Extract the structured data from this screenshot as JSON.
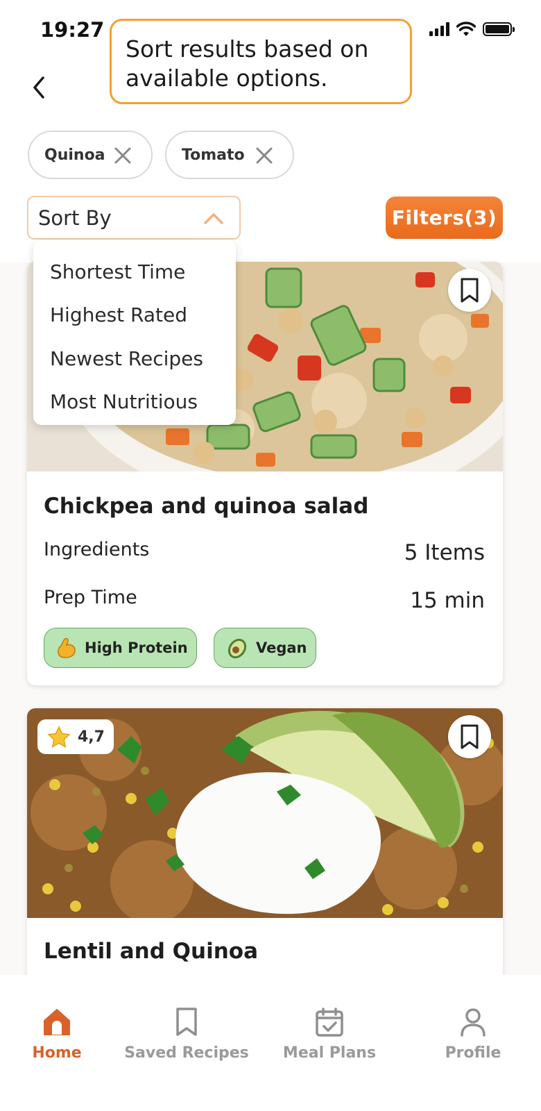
{
  "status_bar": {
    "time": "19:27"
  },
  "tooltip": {
    "text": "Sort results based on available options."
  },
  "chips": [
    {
      "label": "Quinoa"
    },
    {
      "label": "Tomato"
    }
  ],
  "sort": {
    "label": "Sort By",
    "options": [
      "Shortest Time",
      "Highest Rated",
      "Newest Recipes",
      "Most Nutritious"
    ]
  },
  "filters": {
    "label": "Filters(3)"
  },
  "recipes": [
    {
      "title": "Chickpea and quinoa salad",
      "ingredients_label": "Ingredients",
      "ingredients_value": "5 Items",
      "prep_label": "Prep Time",
      "prep_value": "15 min",
      "tags": [
        {
          "icon": "flexed-arm-icon",
          "label": "High Protein"
        },
        {
          "icon": "avocado-icon",
          "label": "Vegan"
        }
      ]
    },
    {
      "title": "Lentil and Quinoa",
      "rating": "4,7"
    }
  ],
  "nav": {
    "items": [
      {
        "label": "Home",
        "icon": "home-icon",
        "active": true
      },
      {
        "label": "Saved Recipes",
        "icon": "bookmark-icon",
        "active": false
      },
      {
        "label": "Meal Plans",
        "icon": "calendar-check-icon",
        "active": false
      },
      {
        "label": "Profile",
        "icon": "person-icon",
        "active": false
      }
    ]
  },
  "colors": {
    "accent": "#ea6a1c",
    "tooltip_border": "#f2a031",
    "tag_bg": "#b9e4b4",
    "nav_active": "#d9622a"
  }
}
